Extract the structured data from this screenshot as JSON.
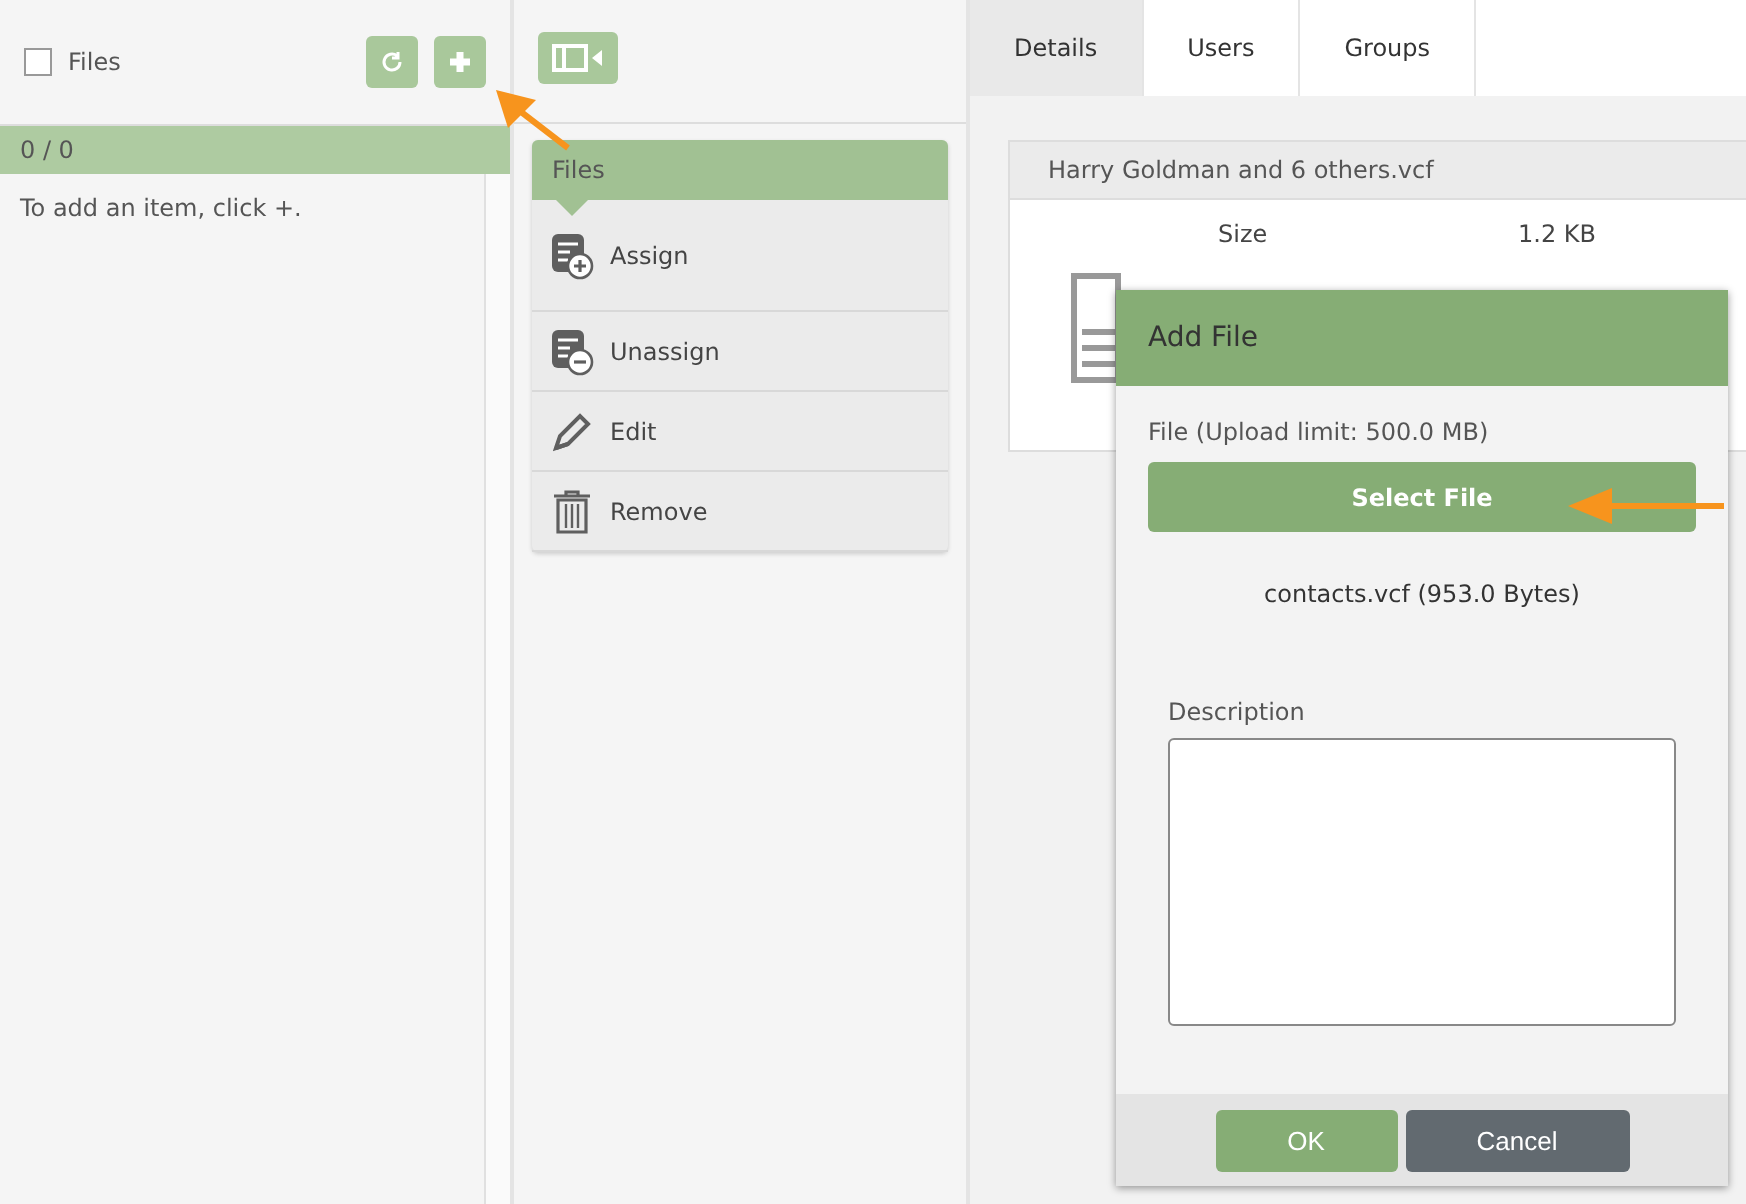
{
  "list_panel": {
    "select_all": {
      "label": "Files",
      "checked": false
    },
    "counter": "0 / 0",
    "empty_message": "To add an item, click +."
  },
  "actions_panel": {
    "header": "Files",
    "items": [
      {
        "kind": "assign",
        "label": "Assign"
      },
      {
        "kind": "unassign",
        "label": "Unassign"
      },
      {
        "kind": "edit",
        "label": "Edit"
      },
      {
        "kind": "remove",
        "label": "Remove"
      }
    ]
  },
  "tabs": [
    {
      "label": "Details",
      "selected": true
    },
    {
      "label": "Users",
      "selected": false
    },
    {
      "label": "Groups",
      "selected": false
    }
  ],
  "details": {
    "title": "Harry Goldman and 6 others.vcf",
    "fields": [
      {
        "label": "Size",
        "value": "1.2 KB"
      }
    ]
  },
  "dialog": {
    "title": "Add File",
    "file_label": "File (Upload limit: 500.0 MB)",
    "select_button": "Select File",
    "selected_file": "contacts.vcf (953.0 Bytes)",
    "description_label": "Description",
    "buttons": [
      {
        "kind": "primary",
        "label": "OK"
      },
      {
        "kind": "secondary",
        "label": "Cancel"
      }
    ]
  }
}
